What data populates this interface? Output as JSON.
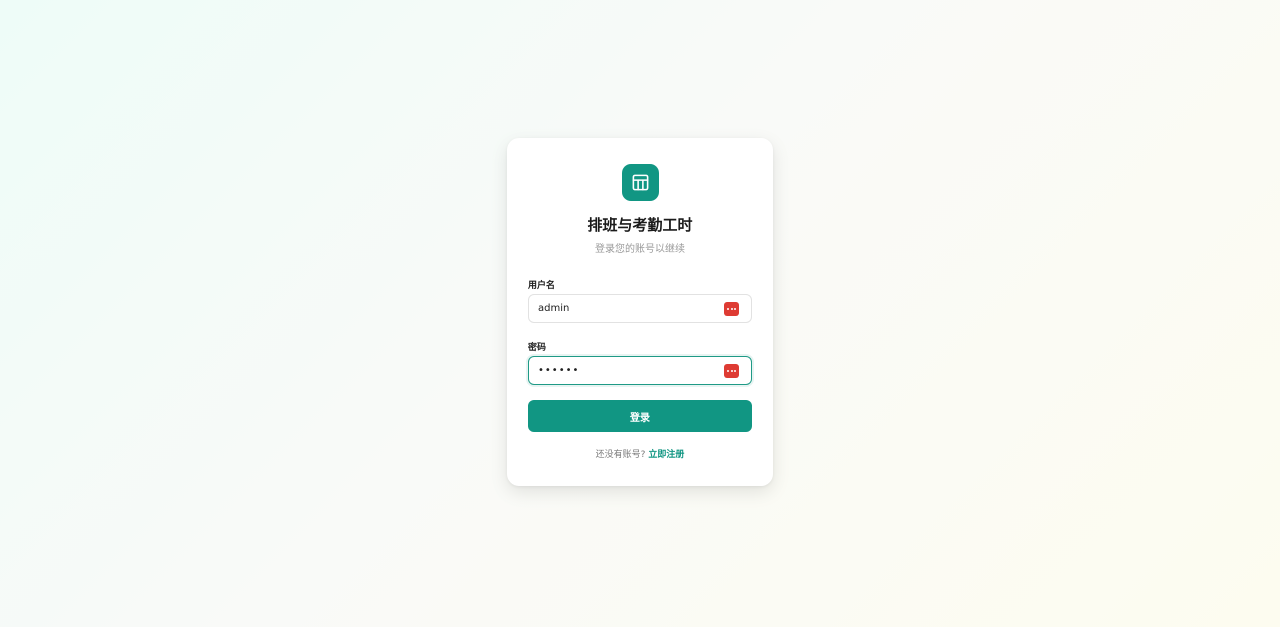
{
  "app": {
    "title": "排班与考勤工时",
    "subtitle": "登录您的账号以继续"
  },
  "form": {
    "username_label": "用户名",
    "username_value": "admin",
    "password_label": "密码",
    "password_value": "••••••",
    "submit_label": "登录"
  },
  "footer": {
    "prompt": "还没有账号?",
    "register_link": "立即注册"
  },
  "icons": {
    "logo": "table-grid-icon",
    "password_manager": "password-manager-icon"
  },
  "colors": {
    "accent": "#119683",
    "password_manager_icon": "#de3b33"
  }
}
